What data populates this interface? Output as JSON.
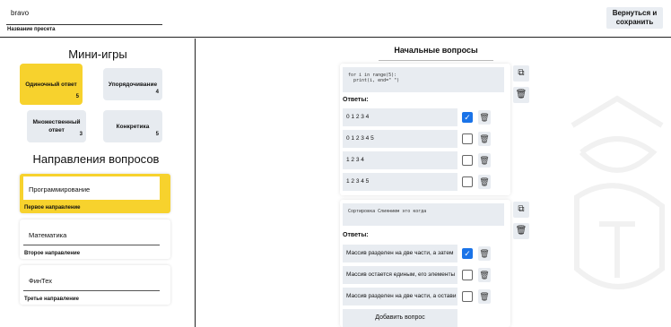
{
  "preset": {
    "value": "bravo",
    "label": "Название пресета"
  },
  "back_button": "Вернуться и сохранить",
  "minigames": {
    "title": "Мини-игры",
    "items": [
      {
        "label": "Одиночный ответ",
        "count": "5",
        "active": true
      },
      {
        "label": "Упорядочивание",
        "count": "4",
        "active": false
      },
      {
        "label": "Множественный ответ",
        "count": "3",
        "active": false
      },
      {
        "label": "Конкретика",
        "count": "5",
        "active": false
      }
    ]
  },
  "directions": {
    "title": "Направления вопросов",
    "items": [
      {
        "value": "Программирование",
        "label": "Первое направление",
        "active": true
      },
      {
        "value": "Математика",
        "label": "Второе направление",
        "active": false
      },
      {
        "value": "ФинТех",
        "label": "Третье направление",
        "active": false
      }
    ]
  },
  "tab_title": "Начальные вопросы",
  "questions": [
    {
      "code": "for i in range(5):\n  print(i, end=\" \")",
      "answers_label": "Ответы:",
      "answers": [
        {
          "text": "0 1 2 3 4",
          "checked": true
        },
        {
          "text": "0 1 2 3 4 5",
          "checked": false
        },
        {
          "text": "1 2 3 4",
          "checked": false
        },
        {
          "text": "1 2 3 4 5",
          "checked": false
        }
      ]
    },
    {
      "code": "Сортировка Слиянием это когда",
      "answers_label": "Ответы:",
      "answers": [
        {
          "text": "Массив разделен на две части, а затем",
          "checked": true
        },
        {
          "text": "Массив остается единым, его элементы",
          "checked": false
        },
        {
          "text": "Массив разделен на две части, а остави",
          "checked": false
        }
      ]
    }
  ],
  "add_question": "Добавить вопрос",
  "icons": {
    "copy": "copy-icon",
    "delete": "trash-icon",
    "check": "check-icon"
  },
  "colors": {
    "accent": "#f7d22d",
    "checkbox": "#1a73e8",
    "card": "#e8ecf1"
  }
}
